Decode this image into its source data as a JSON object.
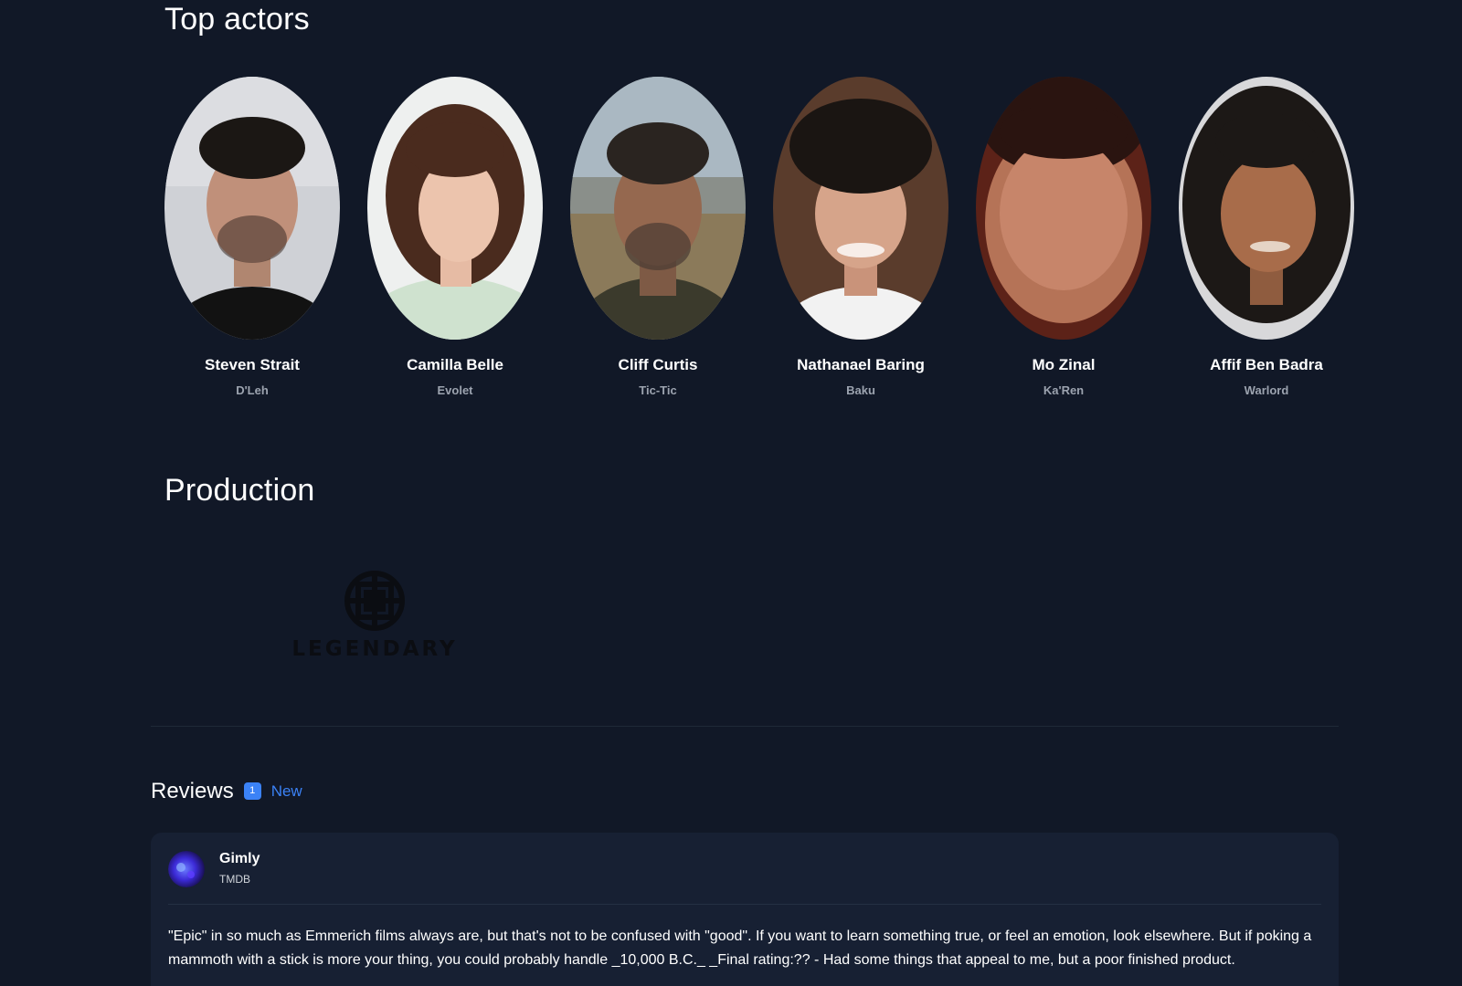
{
  "top_actors": {
    "title": "Top actors",
    "actors": [
      {
        "name": "Steven Strait",
        "role": "D'Leh",
        "portrait_icon": "actor-portrait"
      },
      {
        "name": "Camilla Belle",
        "role": "Evolet",
        "portrait_icon": "actor-portrait"
      },
      {
        "name": "Cliff Curtis",
        "role": "Tic-Tic",
        "portrait_icon": "actor-portrait"
      },
      {
        "name": "Nathanael Baring",
        "role": "Baku",
        "portrait_icon": "actor-portrait"
      },
      {
        "name": "Mo Zinal",
        "role": "Ka'Ren",
        "portrait_icon": "actor-portrait"
      },
      {
        "name": "Affif Ben Badra",
        "role": "Warlord",
        "portrait_icon": "actor-portrait"
      }
    ]
  },
  "production": {
    "title": "Production",
    "companies": [
      {
        "name": "LEGENDARY",
        "logo_icon": "legendary-knot-logo"
      }
    ]
  },
  "reviews": {
    "title": "Reviews",
    "count": "1",
    "new_label": "New",
    "items": [
      {
        "author": "Gimly",
        "source": "TMDB",
        "body": "\"Epic\" in so much as Emmerich films always are, but that's not to be confused with \"good\". If you want to learn something true, or feel an emotion, look elsewhere. But if poking a mammoth with a stick is more your thing, you could probably handle _10,000 B.C._ _Final rating:?? - Had some things that appeal to me, but a poor finished product."
      }
    ]
  },
  "colors": {
    "background": "#111827",
    "card": "#172033",
    "accent": "#3b82f6",
    "muted_text": "#9ca3af"
  }
}
